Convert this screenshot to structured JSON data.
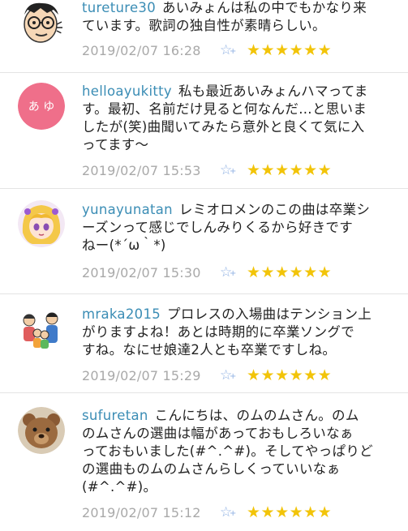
{
  "comments": [
    {
      "user": "tureture30",
      "text": "あいみょんは私の中でもかなり来\nています。歌詞の独自性が素晴らしい。",
      "date": "2019/02/07 16:28",
      "fav_icon": "star-plus-icon",
      "stars": "★★★★★★",
      "avatar": "cartoon-glasses-face"
    },
    {
      "user": "helloayukitty",
      "text": "私も最近あいみょんハマってま\nす。最初、名前だけ見ると何なんだ…と思いま\nしたが(笑)曲聞いてみたら意外と良くて気に入\nってます〜",
      "date": "2019/02/07 15:53",
      "fav_icon": "star-plus-icon",
      "stars": "★★★★★★",
      "avatar": "pink-circle-initials",
      "avatar_text": "あ ゆ",
      "avatar_color": "#ef6f8a"
    },
    {
      "user": "yunayunatan",
      "text": "レミオロメンのこの曲は卒業シ\nーズンって感じでしんみりくるから好きです\nねー(*´ω｀*)",
      "date": "2019/02/07 15:30",
      "fav_icon": "star-plus-icon",
      "stars": "★★★★★★",
      "avatar": "anime-girl"
    },
    {
      "user": "mraka2015",
      "text": "プロレスの入場曲はテンション上\nがりますよね！あとは時期的に卒業ソングで\nすね。なにせ娘達2人とも卒業ですしね。",
      "date": "2019/02/07 15:29",
      "fav_icon": "star-plus-icon",
      "stars": "★★★★★★",
      "avatar": "family-illustration"
    },
    {
      "user": "sufuretan",
      "text": "こんにちは、のムのムさん。のム\nのムさんの選曲は幅があっておもしろいなぁ\nっておもいました(#^.^#)。そしてやっぱりど\nの選曲ものムのムさんらしくっていいなぁ\n(#^.^#)。",
      "date": "2019/02/07 15:12",
      "fav_icon": "star-plus-icon",
      "stars": "★★★★★★",
      "avatar": "teddy-bear-photo"
    }
  ]
}
